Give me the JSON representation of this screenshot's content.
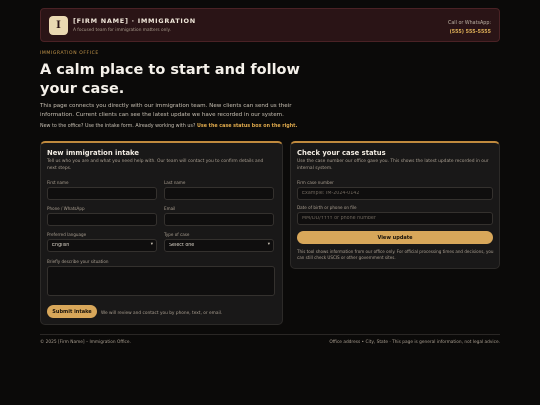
{
  "header": {
    "logo_letter": "I",
    "title": "[FIRM NAME] · IMMIGRATION",
    "tagline": "A focused team for immigration matters only.",
    "contact_label": "Call or WhatsApp:",
    "contact_phone": "(555) 555-5555"
  },
  "hero": {
    "eyebrow": "IMMIGRATION OFFICE",
    "title": "A calm place to start and follow your case.",
    "description": "This page connects you directly with our immigration team. New clients can send us their information. Current clients can see the latest update we have recorded in our system.",
    "note_prefix": "New to the office? Use the intake form. Already working with us?",
    "note_link": "Use the case status box on the right."
  },
  "intake": {
    "title": "New immigration intake",
    "description": "Tell us who you are and what you need help with. Our team will contact you to confirm details and next steps.",
    "first_name_label": "First name",
    "last_name_label": "Last name",
    "phone_label": "Phone / WhatsApp",
    "email_label": "Email",
    "language_label": "Preferred language",
    "language_value": "English",
    "case_type_label": "Type of case",
    "case_type_value": "Select one",
    "situation_label": "Briefly describe your situation",
    "submit_label": "Submit intake",
    "submit_note": "We will review and contact you by phone, text, or email."
  },
  "status": {
    "title": "Check your case status",
    "description": "Use the case number our office gave you. This shows the latest update recorded in our internal system.",
    "case_number_label": "Firm case number",
    "case_number_placeholder": "Example: IM-2024-0142",
    "dob_label": "Date of birth or phone on file",
    "dob_placeholder": "MM/DD/YYYY or phone number",
    "view_label": "View update",
    "footnote": "This tool shows information from our office only. For official processing times and decisions, you can still check USCIS or other government sites."
  },
  "footer": {
    "left": "© 2025 [Firm Name] – Immigration Office.",
    "right": "Office address • City, State · This page is general information, not legal advice."
  },
  "colors": {
    "accent": "#d8a75a",
    "header_bg": "#2a1416",
    "page_bg": "#0b0a09",
    "card_bg": "#191818"
  }
}
